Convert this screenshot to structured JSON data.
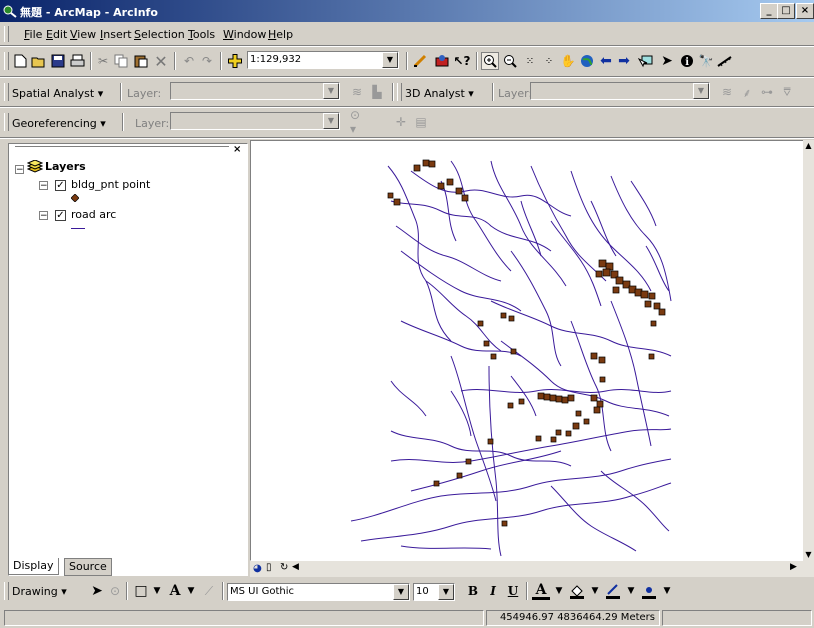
{
  "window": {
    "title": "無題 - ArcMap - ArcInfo",
    "minimize": "_",
    "restore": "□",
    "close": "×"
  },
  "menu": [
    {
      "label": "File",
      "key": "F"
    },
    {
      "label": "Edit",
      "key": "E"
    },
    {
      "label": "View",
      "key": "V"
    },
    {
      "label": "Insert",
      "key": "I"
    },
    {
      "label": "Selection",
      "key": "S"
    },
    {
      "label": "Tools",
      "key": "T"
    },
    {
      "label": "Window",
      "key": "W"
    },
    {
      "label": "Help",
      "key": "H"
    }
  ],
  "standard_toolbar": {
    "scale": "1:129,932",
    "icons": [
      "new-icon",
      "open-icon",
      "save-icon",
      "print-icon",
      "cut-icon",
      "copy-icon",
      "paste-icon",
      "delete-icon",
      "undo-icon",
      "redo-icon",
      "add-data-icon"
    ]
  },
  "tools_toolbar": {
    "icons": [
      "editor-icon",
      "arctoolbox-icon",
      "whats-this-icon",
      "zoom-in-icon",
      "zoom-out-icon",
      "fixed-zoom-in-icon",
      "fixed-zoom-out-icon",
      "pan-icon",
      "full-extent-icon",
      "back-icon",
      "forward-icon",
      "select-features-icon",
      "select-elements-icon",
      "identify-icon",
      "find-icon",
      "measure-icon"
    ]
  },
  "spatial_analyst": {
    "label": "Spatial Analyst",
    "key": "A",
    "layer_label": "Layer:"
  },
  "analyst_3d": {
    "label": "3D Analyst",
    "key": "D",
    "layer_label": "Layer:"
  },
  "georeferencing": {
    "label": "Georeferencing",
    "key": "G",
    "layer_label": "Layer:"
  },
  "toc": {
    "root_label": "Layers",
    "layers": [
      {
        "name": "bldg_pnt point",
        "checked": true,
        "symbol": "point"
      },
      {
        "name": "road arc",
        "checked": true,
        "symbol": "line"
      }
    ],
    "tabs": [
      "Display",
      "Source"
    ]
  },
  "draw_toolbar": {
    "drawing_label": "Drawing",
    "drawing_key": "D",
    "font": "MS UI Gothic",
    "font_size": "10",
    "bold": "B",
    "italic": "I",
    "underline": "U",
    "font_color_glyph": "A"
  },
  "status": {
    "coordinates": "454946.97  4836464.29 Meters"
  },
  "colors": {
    "road": "#3a1a9a",
    "building_fill": "#7a3a10",
    "title_start": "#0a246a",
    "title_end": "#a6caf0"
  }
}
